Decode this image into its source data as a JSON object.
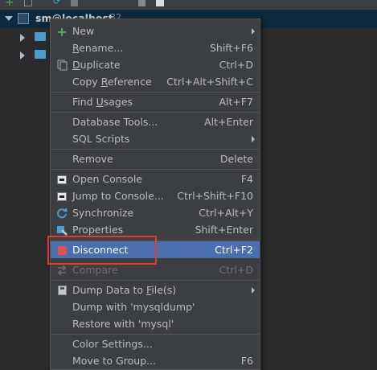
{
  "tree": {
    "host_label": "sm@localhost",
    "host_count": "32"
  },
  "menu": {
    "items": [
      {
        "label": "New",
        "shortcut": "",
        "submenu": true,
        "icon": "plus-icon"
      },
      {
        "label_pre": "",
        "label_u": "R",
        "label_post": "ename...",
        "shortcut": "Shift+F6",
        "icon": ""
      },
      {
        "label_pre": "",
        "label_u": "D",
        "label_post": "uplicate",
        "shortcut": "Ctrl+D",
        "icon": "duplicate-icon"
      },
      {
        "label_pre": "Copy ",
        "label_u": "R",
        "label_post": "eference",
        "shortcut": "Ctrl+Alt+Shift+C",
        "icon": ""
      },
      {
        "label_pre": "Find ",
        "label_u": "U",
        "label_post": "sages",
        "shortcut": "Alt+F7",
        "icon": ""
      },
      {
        "label": "Database Tools...",
        "shortcut": "Alt+Enter",
        "icon": ""
      },
      {
        "label": "SQL Scripts",
        "shortcut": "",
        "submenu": true,
        "icon": ""
      },
      {
        "label": "Remove",
        "shortcut": "Delete",
        "icon": ""
      },
      {
        "label": "Open Console",
        "shortcut": "F4",
        "icon": "console-icon"
      },
      {
        "label": "Jump to Console...",
        "shortcut": "Ctrl+Shift+F10",
        "icon": "console-icon"
      },
      {
        "label": "Synchronize",
        "shortcut": "Ctrl+Alt+Y",
        "icon": "sync-icon"
      },
      {
        "label": "Properties",
        "shortcut": "Shift+Enter",
        "icon": "properties-icon"
      },
      {
        "label": "Disconnect",
        "shortcut": "Ctrl+F2",
        "icon": "stop-icon",
        "highlighted": true
      },
      {
        "label": "Compare",
        "shortcut": "Ctrl+D",
        "icon": "compare-icon",
        "disabled": true
      },
      {
        "label_pre": "Dump Data to ",
        "label_u": "F",
        "label_post": "ile(s)",
        "shortcut": "",
        "submenu": true,
        "icon": "save-icon"
      },
      {
        "label": "Dump with 'mysqldump'",
        "shortcut": "",
        "icon": ""
      },
      {
        "label": "Restore with 'mysql'",
        "shortcut": "",
        "icon": ""
      },
      {
        "label": "Color Settings...",
        "shortcut": "",
        "icon": ""
      },
      {
        "label": "Move to Group...",
        "shortcut": "F6",
        "icon": ""
      }
    ]
  },
  "colors": {
    "highlight": "#4b6eaf",
    "annotation_box": "#e53935"
  }
}
